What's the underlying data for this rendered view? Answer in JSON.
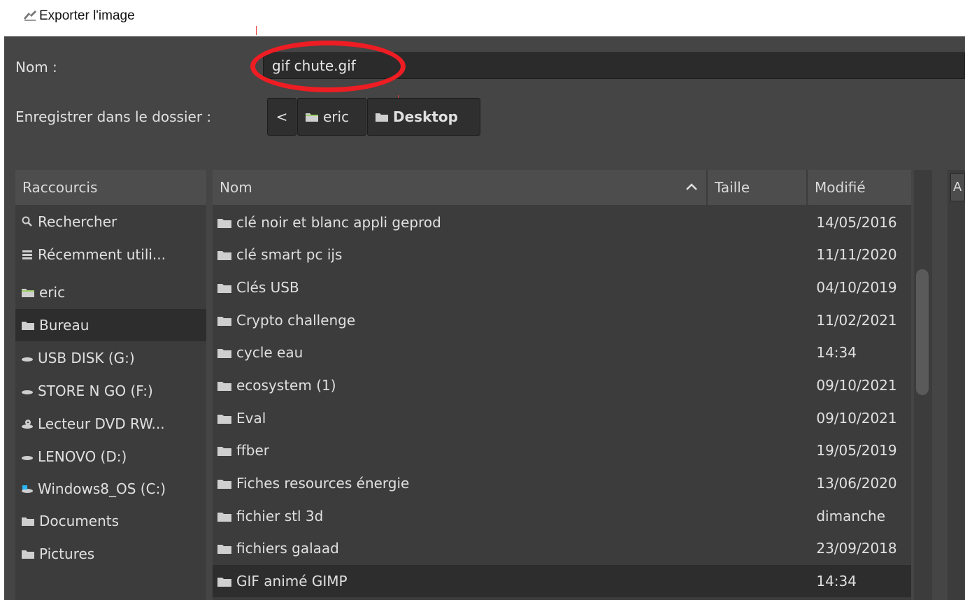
{
  "window": {
    "title": "Exporter l'image"
  },
  "form": {
    "name_label": "Nom :",
    "name_value": "gif chute.gif",
    "folder_label": "Enregistrer dans le dossier :"
  },
  "breadcrumb": {
    "back_label": "<",
    "items": [
      {
        "label": "eric"
      },
      {
        "label": "Desktop"
      }
    ]
  },
  "shortcuts": {
    "header": "Raccourcis",
    "items": [
      {
        "label": "Rechercher",
        "icon": "search-icon"
      },
      {
        "label": "Récemment utili...",
        "icon": "recent-icon"
      },
      {
        "label": "eric",
        "icon": "home-folder-icon"
      },
      {
        "label": "Bureau",
        "icon": "folder-icon"
      },
      {
        "label": "USB DISK (G:)",
        "icon": "drive-icon"
      },
      {
        "label": "STORE N GO (F:)",
        "icon": "drive-icon"
      },
      {
        "label": "Lecteur DVD RW...",
        "icon": "dvd-drive-icon"
      },
      {
        "label": "LENOVO (D:)",
        "icon": "drive-icon"
      },
      {
        "label": "Windows8_OS (C:)",
        "icon": "system-drive-icon"
      },
      {
        "label": "Documents",
        "icon": "folder-icon"
      },
      {
        "label": "Pictures",
        "icon": "folder-icon"
      }
    ],
    "selected_index": 3
  },
  "files": {
    "columns": {
      "name": "Nom",
      "size": "Taille",
      "modified": "Modifié"
    },
    "sort_indicator": "ascending",
    "rows": [
      {
        "name": "clé noir et blanc appli geprod",
        "modified": "14/05/2016"
      },
      {
        "name": "clé smart pc ijs",
        "modified": "11/11/2020"
      },
      {
        "name": "Clés USB",
        "modified": "04/10/2019"
      },
      {
        "name": "Crypto challenge",
        "modified": "11/02/2021"
      },
      {
        "name": "cycle eau",
        "modified": "14:34"
      },
      {
        "name": "ecosystem (1)",
        "modified": "09/10/2021"
      },
      {
        "name": "Eval",
        "modified": "09/10/2021"
      },
      {
        "name": "ffber",
        "modified": "19/05/2019"
      },
      {
        "name": "Fiches resources énergie",
        "modified": "13/06/2020"
      },
      {
        "name": "fichier stl 3d",
        "modified": "dimanche"
      },
      {
        "name": "fichiers galaad",
        "modified": "23/09/2018"
      },
      {
        "name": "GIF animé GIMP",
        "modified": "14:34"
      }
    ],
    "selected_index": 11
  },
  "right_panel": {
    "button_label": "A"
  },
  "colors": {
    "dialog_bg": "#454545",
    "panel_bg": "#3c3c3c",
    "header_bg": "#4d4d4d",
    "selected_bg": "#2d2d2d",
    "text": "#e0e0e0",
    "highlight_circle": "#ee1d23"
  }
}
